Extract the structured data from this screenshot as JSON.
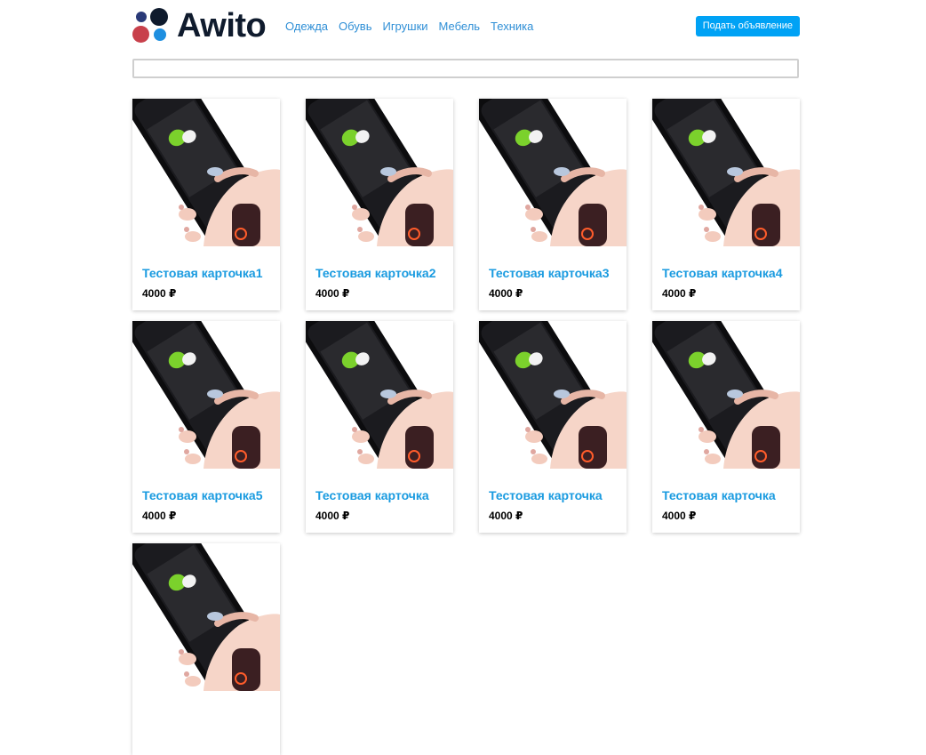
{
  "header": {
    "logo_text": "Awito",
    "nav": [
      "Одежда",
      "Обувь",
      "Игрушки",
      "Мебель",
      "Техника"
    ],
    "post_button_label": "Подать объявление"
  },
  "search": {
    "value": "",
    "placeholder": ""
  },
  "cards": [
    {
      "title": "Тестовая карточка1",
      "price": "4000 ₽",
      "image": "phone-in-hand"
    },
    {
      "title": "Тестовая карточка2",
      "price": "4000 ₽",
      "image": "phone-in-hand"
    },
    {
      "title": "Тестовая карточка3",
      "price": "4000 ₽",
      "image": "phone-in-hand"
    },
    {
      "title": "Тестовая карточка4",
      "price": "4000 ₽",
      "image": "phone-in-hand"
    },
    {
      "title": "Тестовая карточка5",
      "price": "4000 ₽",
      "image": "phone-in-hand"
    },
    {
      "title": "Тестовая карточка",
      "price": "4000 ₽",
      "image": "phone-in-hand"
    },
    {
      "title": "Тестовая карточка",
      "price": "4000 ₽",
      "image": "phone-in-hand"
    },
    {
      "title": "Тестовая карточка",
      "price": "4000 ₽",
      "image": "phone-in-hand"
    },
    {
      "title": "",
      "price": "",
      "image": "phone-in-hand"
    }
  ],
  "colors": {
    "accent": "#00a2f5",
    "link": "#2f8fd6",
    "card_title": "#1a9be0",
    "logo_dark": "#0f1b2d",
    "logo_red": "#c8404b",
    "logo_blue": "#1e8fe0",
    "logo_navy": "#2a3a78"
  }
}
